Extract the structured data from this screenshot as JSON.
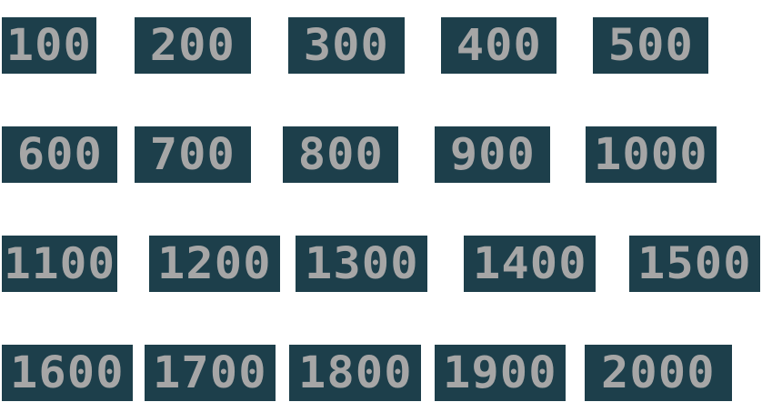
{
  "colors": {
    "background": "#ffffff",
    "tile": "#1d3f4b",
    "text": "#a6a6a6"
  },
  "rows": [
    [
      {
        "label": "100"
      },
      {
        "label": "200"
      },
      {
        "label": "300"
      },
      {
        "label": "400"
      },
      {
        "label": "500"
      }
    ],
    [
      {
        "label": "600"
      },
      {
        "label": "700"
      },
      {
        "label": "800"
      },
      {
        "label": "900"
      },
      {
        "label": "1000"
      }
    ],
    [
      {
        "label": "1100"
      },
      {
        "label": "1200"
      },
      {
        "label": "1300"
      },
      {
        "label": "1400"
      },
      {
        "label": "1500"
      }
    ],
    [
      {
        "label": "1600"
      },
      {
        "label": "1700"
      },
      {
        "label": "1800"
      },
      {
        "label": "1900"
      },
      {
        "label": "2000"
      }
    ]
  ]
}
